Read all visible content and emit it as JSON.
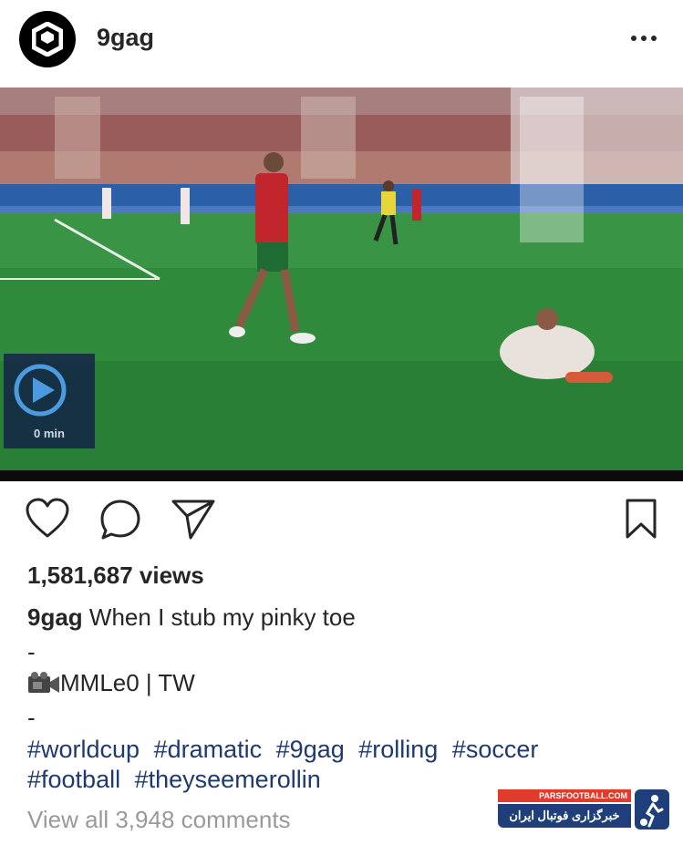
{
  "header": {
    "username": "9gag",
    "avatar_icon": "9gag-logo-icon",
    "more_icon": "more-dots-icon"
  },
  "video": {
    "overlay_time": "0 min",
    "play_icon": "play-icon"
  },
  "actions": {
    "like_icon": "heart-icon",
    "comment_icon": "comment-icon",
    "share_icon": "send-icon",
    "save_icon": "bookmark-icon"
  },
  "post": {
    "views": "1,581,687 views",
    "caption_user": "9gag",
    "caption_text": "When I stub my pinky toe",
    "dash1": "-",
    "credit_icon": "video-camera-icon",
    "credit": "MMLe0 | TW",
    "dash2": "-",
    "hashtags": [
      "#worldcup",
      "#dramatic",
      "#9gag",
      "#rolling",
      "#soccer",
      "#football",
      "#theyseemerollin"
    ],
    "comments_link": "View all 3,948 comments"
  },
  "watermark": {
    "top": "PARSFOOTBALL.COM",
    "bottom": "خبرگزاری فوتبال ایران"
  },
  "colors": {
    "text": "#262626",
    "hashtag": "#1e3a6e",
    "muted": "#999999",
    "pitch": "#2f8a3c"
  }
}
